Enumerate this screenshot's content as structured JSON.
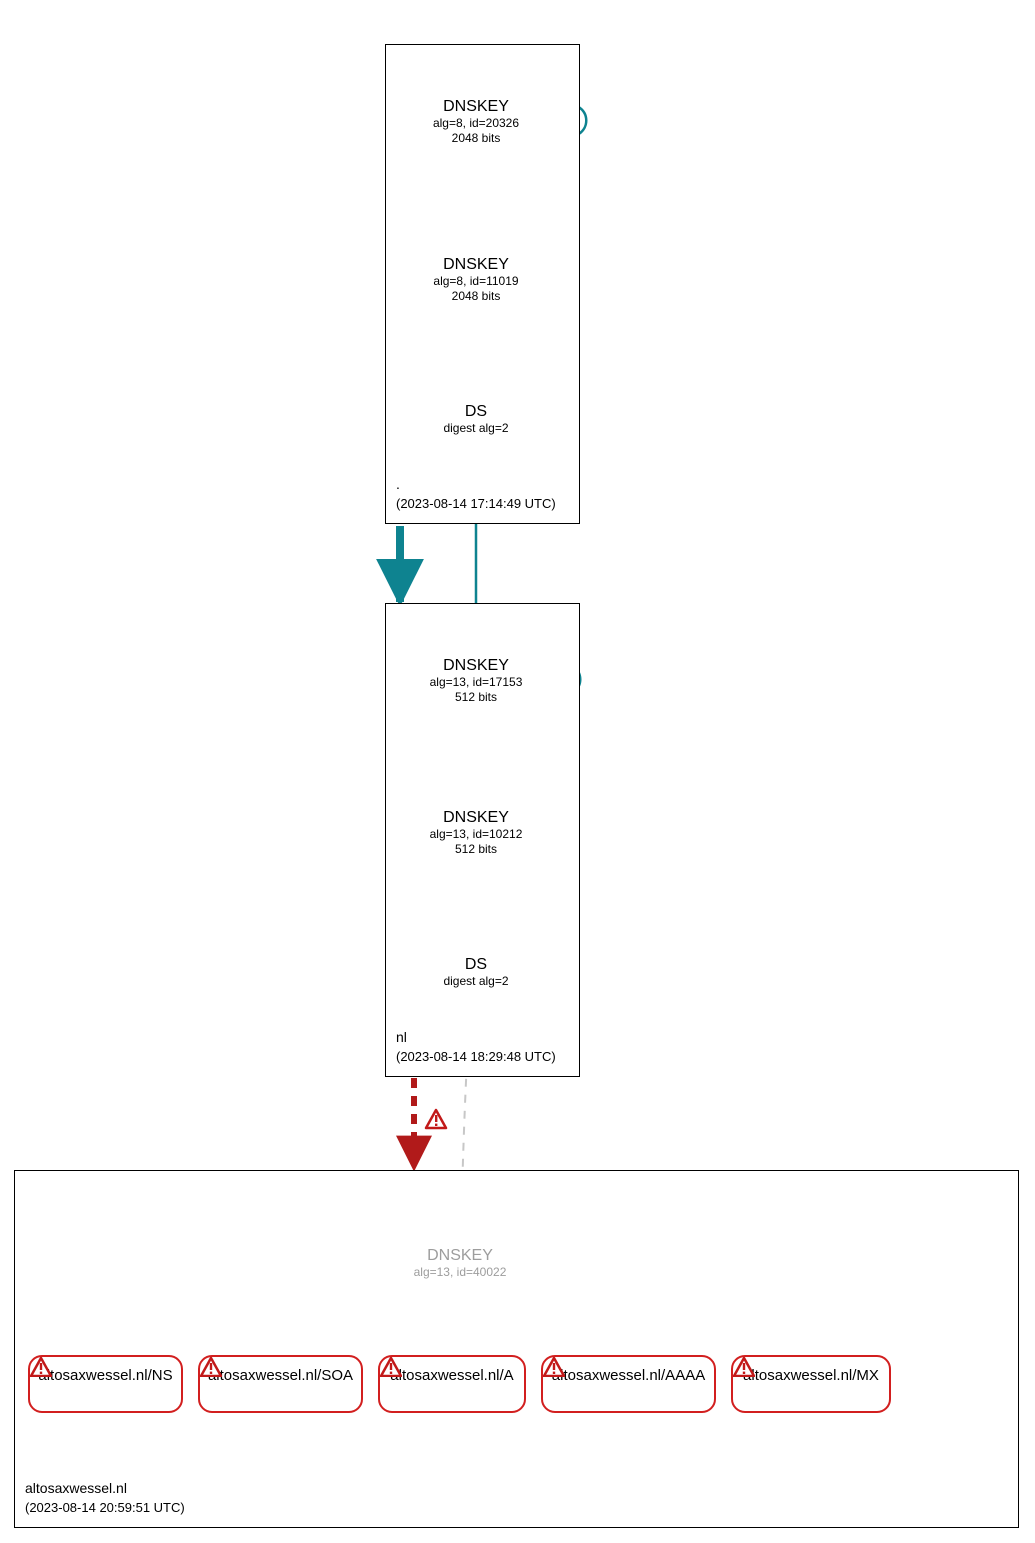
{
  "chart_data": {
    "type": "diagram",
    "description": "DNSSEC authentication graph (DNSViz-style) for altosaxwessel.nl",
    "zones": [
      {
        "name": ".",
        "timestamp": "2023-08-14 17:14:49 UTC",
        "nodes": [
          {
            "id": "root_ksk",
            "type": "DNSKEY",
            "label": "DNSKEY",
            "detail1": "alg=8, id=20326",
            "detail2": "2048 bits",
            "style": "ksk"
          },
          {
            "id": "root_zsk",
            "type": "DNSKEY",
            "label": "DNSKEY",
            "detail1": "alg=8, id=11019",
            "detail2": "2048 bits",
            "style": "zsk"
          },
          {
            "id": "root_ds",
            "type": "DS",
            "label": "DS",
            "detail1": "digest alg=2",
            "style": "ds"
          }
        ],
        "edges": [
          {
            "from": "root_ksk",
            "to": "root_ksk",
            "kind": "self"
          },
          {
            "from": "root_ksk",
            "to": "root_zsk",
            "kind": "secure"
          },
          {
            "from": "root_zsk",
            "to": "root_ds",
            "kind": "secure"
          }
        ]
      },
      {
        "name": "nl",
        "timestamp": "2023-08-14 18:29:48 UTC",
        "nodes": [
          {
            "id": "nl_ksk",
            "type": "DNSKEY",
            "label": "DNSKEY",
            "detail1": "alg=13, id=17153",
            "detail2": "512 bits",
            "style": "ksk"
          },
          {
            "id": "nl_zsk",
            "type": "DNSKEY",
            "label": "DNSKEY",
            "detail1": "alg=13, id=10212",
            "detail2": "512 bits",
            "style": "zsk"
          },
          {
            "id": "nl_ds",
            "type": "DS",
            "label": "DS",
            "detail1": "digest alg=2",
            "style": "ds"
          }
        ],
        "edges": [
          {
            "from": "root_ds",
            "to": "nl_ksk",
            "kind": "secure"
          },
          {
            "from": "root_zone",
            "to": "nl_zone",
            "kind": "delegation_secure"
          },
          {
            "from": "nl_ksk",
            "to": "nl_ksk",
            "kind": "self"
          },
          {
            "from": "nl_ksk",
            "to": "nl_zsk",
            "kind": "secure"
          },
          {
            "from": "nl_zsk",
            "to": "nl_ds",
            "kind": "secure"
          }
        ]
      },
      {
        "name": "altosaxwessel.nl",
        "timestamp": "2023-08-14 20:59:51 UTC",
        "nodes": [
          {
            "id": "aw_dnskey",
            "type": "DNSKEY",
            "label": "DNSKEY",
            "detail1": "alg=13, id=40022",
            "style": "missing"
          }
        ],
        "rrsets": [
          {
            "id": "aw_ns",
            "label": "altosaxwessel.nl/NS",
            "status": "error"
          },
          {
            "id": "aw_soa",
            "label": "altosaxwessel.nl/SOA",
            "status": "error"
          },
          {
            "id": "aw_a",
            "label": "altosaxwessel.nl/A",
            "status": "error"
          },
          {
            "id": "aw_aaaa",
            "label": "altosaxwessel.nl/AAAA",
            "status": "error"
          },
          {
            "id": "aw_mx",
            "label": "altosaxwessel.nl/MX",
            "status": "error"
          }
        ],
        "edges": [
          {
            "from": "nl_zone",
            "to": "aw_zone",
            "kind": "delegation_bogus",
            "status": "error"
          },
          {
            "from": "nl_ds",
            "to": "aw_dnskey",
            "kind": "insecure_missing"
          }
        ]
      }
    ]
  },
  "colors": {
    "secure_teal": "#0e8390",
    "error_red": "#c21919",
    "missing_grey": "#c7c7c7",
    "node_fill_ksk": "#e5e5e5"
  },
  "zone_root": {
    "name": ".",
    "timestamp": "(2023-08-14 17:14:49 UTC)"
  },
  "zone_nl": {
    "name": "nl",
    "timestamp": "(2023-08-14 18:29:48 UTC)"
  },
  "zone_aw": {
    "name": "altosaxwessel.nl",
    "timestamp": "(2023-08-14 20:59:51 UTC)"
  },
  "nodes": {
    "root_ksk": {
      "title": "DNSKEY",
      "l1": "alg=8, id=20326",
      "l2": "2048 bits"
    },
    "root_zsk": {
      "title": "DNSKEY",
      "l1": "alg=8, id=11019",
      "l2": "2048 bits"
    },
    "root_ds": {
      "title": "DS",
      "l1": "digest alg=2"
    },
    "nl_ksk": {
      "title": "DNSKEY",
      "l1": "alg=13, id=17153",
      "l2": "512 bits"
    },
    "nl_zsk": {
      "title": "DNSKEY",
      "l1": "alg=13, id=10212",
      "l2": "512 bits"
    },
    "nl_ds": {
      "title": "DS",
      "l1": "digest alg=2"
    },
    "aw_dnskey": {
      "title": "DNSKEY",
      "l1": "alg=13, id=40022"
    }
  },
  "rr": {
    "ns": "altosaxwessel.nl/NS",
    "soa": "altosaxwessel.nl/SOA",
    "a": "altosaxwessel.nl/A",
    "aaaa": "altosaxwessel.nl/AAAA",
    "mx": "altosaxwessel.nl/MX"
  }
}
